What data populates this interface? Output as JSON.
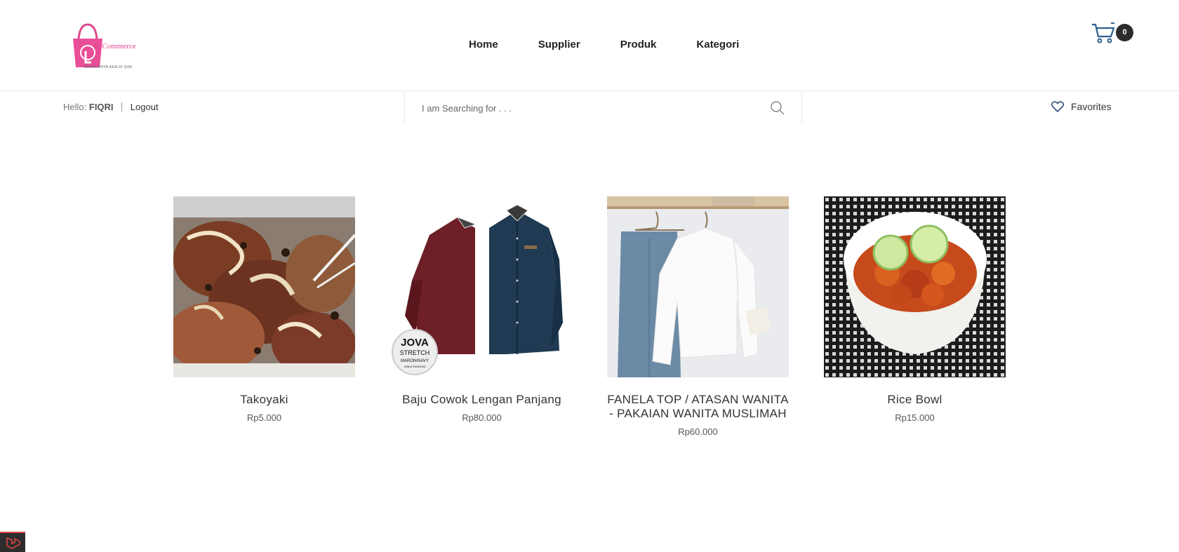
{
  "brand": {
    "name": "E-Commerce",
    "tagline": "SEGALANYA ADA DI SINI",
    "logo_color": "#e0468d"
  },
  "nav": {
    "items": [
      {
        "label": "Home"
      },
      {
        "label": "Supplier"
      },
      {
        "label": "Produk"
      },
      {
        "label": "Kategori"
      }
    ]
  },
  "cart": {
    "count": "0",
    "icon": "cart-icon"
  },
  "user": {
    "greeting": "Hello:",
    "name": "FIQRI",
    "logout": "Logout"
  },
  "search": {
    "placeholder": "I am Searching for . . .",
    "value": ""
  },
  "favorites": {
    "label": "Favorites",
    "icon": "heart-icon"
  },
  "products": [
    {
      "name": "Takoyaki",
      "price": "Rp5.000"
    },
    {
      "name": "Baju Cowok Lengan Panjang",
      "price": "Rp80.000"
    },
    {
      "name": "FANELA TOP / ATASAN WANITA - PAKAIAN WANITA MUSLIMAH",
      "price": "Rp60.000"
    },
    {
      "name": "Rice Bowl",
      "price": "Rp15.000"
    }
  ],
  "product_images": {
    "shirt_badge": [
      "JOVA",
      "STRETCH",
      "MARON/NAVY",
      "VINKA FASHION"
    ]
  }
}
